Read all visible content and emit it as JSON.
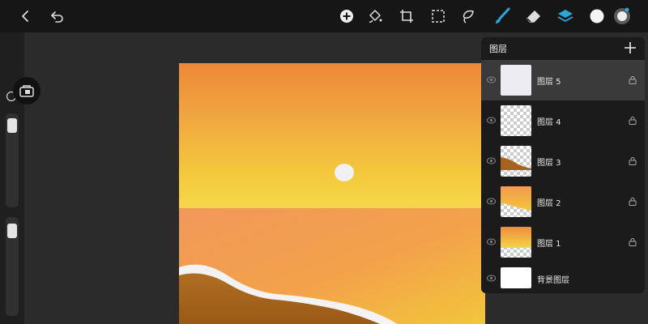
{
  "toolbar": {
    "icons": [
      "back-chevron-icon",
      "undo-icon",
      "adjustments-plus-icon",
      "fill-bucket-icon",
      "crop-transform-icon",
      "selection-icon",
      "lasso-icon",
      "brush-icon",
      "eraser-icon",
      "layers-icon",
      "color-swatch-icon",
      "avatar-icon"
    ],
    "accent_color": "#27a8d8"
  },
  "layers_panel": {
    "title": "图层",
    "add_icon": "plus-icon",
    "layers": [
      {
        "name": "图层 5",
        "visible": true,
        "locked": true,
        "active": true
      },
      {
        "name": "图层 4",
        "visible": true,
        "locked": true,
        "active": false
      },
      {
        "name": "图层 3",
        "visible": true,
        "locked": true,
        "active": false
      },
      {
        "name": "图层 2",
        "visible": true,
        "locked": true,
        "active": false
      },
      {
        "name": "图层 1",
        "visible": true,
        "locked": true,
        "active": false
      }
    ],
    "background_layer": {
      "name": "背景图层",
      "visible": true
    }
  },
  "canvas": {
    "subject": "sunset over the sea",
    "sky_colors": [
      "#ef8a3c",
      "#f3c03a"
    ],
    "sea_color": "#f39a4e",
    "sand_color": "#a8641c",
    "sun_color": "#f1f1f4"
  }
}
